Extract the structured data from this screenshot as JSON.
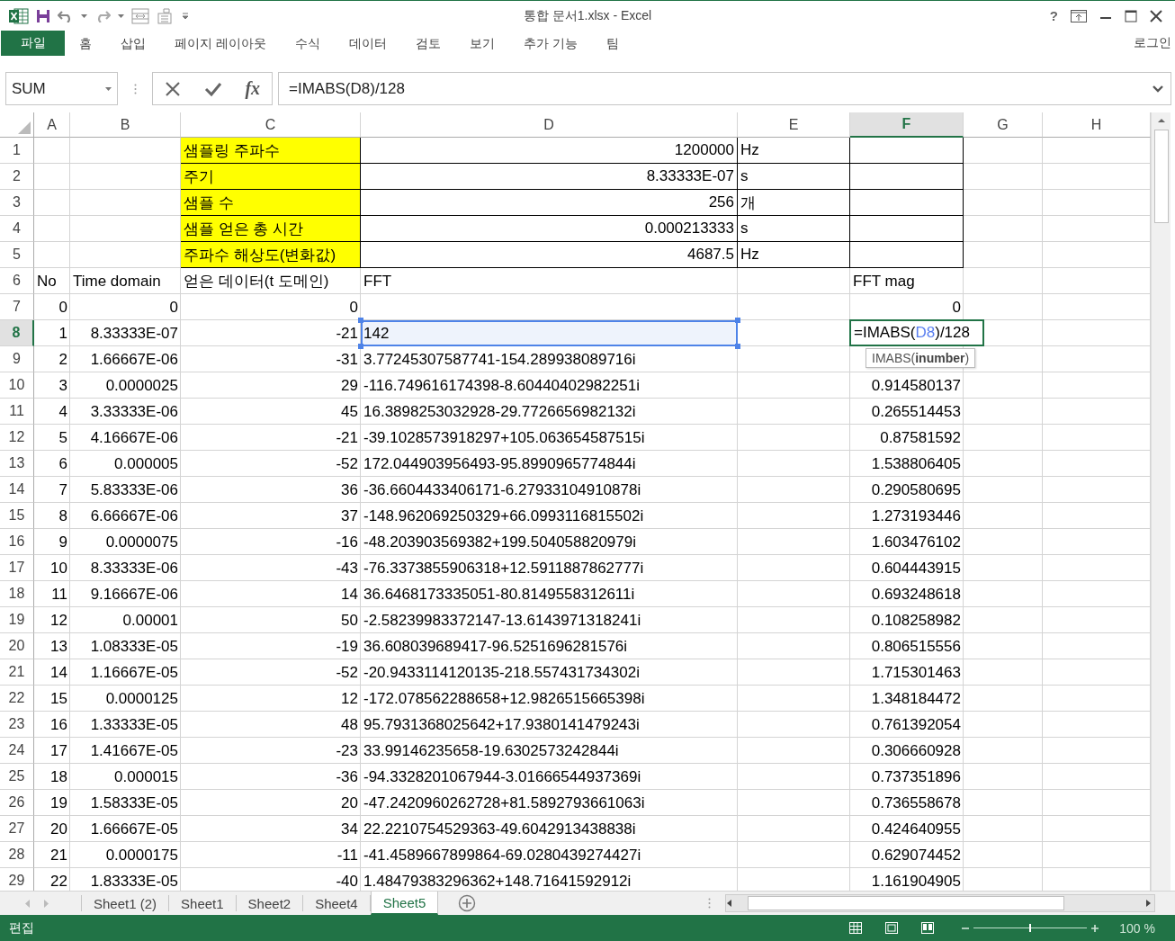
{
  "window": {
    "title": "통합 문서1.xlsx - Excel",
    "help": "?"
  },
  "ribbon_tabs": [
    {
      "label": "파일",
      "kind": "file",
      "selected": false
    },
    {
      "label": "홈",
      "kind": "tab",
      "selected": false
    },
    {
      "label": "삽입",
      "kind": "tab",
      "selected": false
    },
    {
      "label": "페이지 레이아웃",
      "kind": "tab",
      "selected": false
    },
    {
      "label": "수식",
      "kind": "tab",
      "selected": false
    },
    {
      "label": "데이터",
      "kind": "tab",
      "selected": false
    },
    {
      "label": "검토",
      "kind": "tab",
      "selected": false
    },
    {
      "label": "보기",
      "kind": "tab",
      "selected": false
    },
    {
      "label": "추가 기능",
      "kind": "tab",
      "selected": false
    },
    {
      "label": "팀",
      "kind": "tab",
      "selected": false
    }
  ],
  "account": "로그인",
  "formula_bar": {
    "name_box": "SUM",
    "function_button": "fx",
    "formula": "=IMABS(D8)/128"
  },
  "columns": [
    {
      "label": "A",
      "selected": false
    },
    {
      "label": "B",
      "selected": false
    },
    {
      "label": "C",
      "selected": false
    },
    {
      "label": "D",
      "selected": false
    },
    {
      "label": "E",
      "selected": false
    },
    {
      "label": "F",
      "selected": true
    },
    {
      "label": "G",
      "selected": false
    },
    {
      "label": "H",
      "selected": false
    }
  ],
  "rows": [
    {
      "header": "1",
      "selected": false,
      "boxed": true,
      "cells": {
        "C": {
          "text": "샘플링 주파수",
          "kind": "highlight"
        },
        "D": {
          "text": "1200000",
          "kind": "number"
        },
        "E": {
          "text": "Hz",
          "kind": "text"
        }
      }
    },
    {
      "header": "2",
      "selected": false,
      "boxed": true,
      "cells": {
        "C": {
          "text": "주기",
          "kind": "highlight"
        },
        "D": {
          "text": "8.33333E-07",
          "kind": "number"
        },
        "E": {
          "text": "s",
          "kind": "text"
        }
      }
    },
    {
      "header": "3",
      "selected": false,
      "boxed": true,
      "cells": {
        "C": {
          "text": "샘플 수",
          "kind": "highlight"
        },
        "D": {
          "text": "256",
          "kind": "number"
        },
        "E": {
          "text": "개",
          "kind": "text"
        }
      }
    },
    {
      "header": "4",
      "selected": false,
      "boxed": true,
      "cells": {
        "C": {
          "text": "샘플 얻은 총 시간",
          "kind": "highlight"
        },
        "D": {
          "text": "0.000213333",
          "kind": "number"
        },
        "E": {
          "text": "s",
          "kind": "text"
        }
      }
    },
    {
      "header": "5",
      "selected": false,
      "boxed": true,
      "cells": {
        "C": {
          "text": "주파수 해상도(변화값)",
          "kind": "highlight"
        },
        "D": {
          "text": "4687.5",
          "kind": "number"
        },
        "E": {
          "text": "Hz",
          "kind": "text"
        }
      }
    },
    {
      "header": "6",
      "selected": false,
      "cells": {
        "A": {
          "text": "No",
          "kind": "text"
        },
        "B": {
          "text": "Time domain",
          "kind": "text"
        },
        "C": {
          "text": "얻은 데이터(t 도메인)",
          "kind": "text"
        },
        "D": {
          "text": "FFT",
          "kind": "text"
        },
        "F": {
          "text": "FFT mag",
          "kind": "text"
        }
      }
    },
    {
      "header": "7",
      "selected": false,
      "cells": {
        "A": {
          "text": "0",
          "kind": "number"
        },
        "B": {
          "text": "0",
          "kind": "number"
        },
        "C": {
          "text": "0",
          "kind": "number"
        },
        "F": {
          "text": "0",
          "kind": "number"
        }
      }
    },
    {
      "header": "8",
      "selected": true,
      "cells": {
        "A": {
          "text": "1",
          "kind": "number"
        },
        "B": {
          "text": "8.33333E-07",
          "kind": "number"
        },
        "C": {
          "text": "-21",
          "kind": "number"
        },
        "D": {
          "text": "142",
          "kind": "text",
          "referenced": true
        },
        "F": {
          "kind": "editing",
          "text": "=IMABS(",
          "reference": "D8",
          "tail": ")/128"
        }
      }
    },
    {
      "header": "9",
      "selected": false,
      "cells": {
        "A": {
          "text": "2",
          "kind": "number"
        },
        "B": {
          "text": "1.66667E-06",
          "kind": "number"
        },
        "C": {
          "text": "-31",
          "kind": "number"
        },
        "D": {
          "text": "3.77245307587741-154.289938089716i",
          "kind": "text"
        }
      }
    },
    {
      "header": "10",
      "selected": false,
      "cells": {
        "A": {
          "text": "3",
          "kind": "number"
        },
        "B": {
          "text": "0.0000025",
          "kind": "number"
        },
        "C": {
          "text": "29",
          "kind": "number"
        },
        "D": {
          "text": "-116.749616174398-8.60440402982251i",
          "kind": "text"
        },
        "F": {
          "text": "0.914580137",
          "kind": "number"
        }
      }
    },
    {
      "header": "11",
      "selected": false,
      "cells": {
        "A": {
          "text": "4",
          "kind": "number"
        },
        "B": {
          "text": "3.33333E-06",
          "kind": "number"
        },
        "C": {
          "text": "45",
          "kind": "number"
        },
        "D": {
          "text": "16.3898253032928-29.7726656982132i",
          "kind": "text"
        },
        "F": {
          "text": "0.265514453",
          "kind": "number"
        }
      }
    },
    {
      "header": "12",
      "selected": false,
      "cells": {
        "A": {
          "text": "5",
          "kind": "number"
        },
        "B": {
          "text": "4.16667E-06",
          "kind": "number"
        },
        "C": {
          "text": "-21",
          "kind": "number"
        },
        "D": {
          "text": "-39.1028573918297+105.063654587515i",
          "kind": "text"
        },
        "F": {
          "text": "0.87581592",
          "kind": "number"
        }
      }
    },
    {
      "header": "13",
      "selected": false,
      "cells": {
        "A": {
          "text": "6",
          "kind": "number"
        },
        "B": {
          "text": "0.000005",
          "kind": "number"
        },
        "C": {
          "text": "-52",
          "kind": "number"
        },
        "D": {
          "text": "172.044903956493-95.8990965774844i",
          "kind": "text"
        },
        "F": {
          "text": "1.538806405",
          "kind": "number"
        }
      }
    },
    {
      "header": "14",
      "selected": false,
      "cells": {
        "A": {
          "text": "7",
          "kind": "number"
        },
        "B": {
          "text": "5.83333E-06",
          "kind": "number"
        },
        "C": {
          "text": "36",
          "kind": "number"
        },
        "D": {
          "text": "-36.6604433406171-6.27933104910878i",
          "kind": "text"
        },
        "F": {
          "text": "0.290580695",
          "kind": "number"
        }
      }
    },
    {
      "header": "15",
      "selected": false,
      "cells": {
        "A": {
          "text": "8",
          "kind": "number"
        },
        "B": {
          "text": "6.66667E-06",
          "kind": "number"
        },
        "C": {
          "text": "37",
          "kind": "number"
        },
        "D": {
          "text": "-148.962069250329+66.0993116815502i",
          "kind": "text"
        },
        "F": {
          "text": "1.273193446",
          "kind": "number"
        }
      }
    },
    {
      "header": "16",
      "selected": false,
      "cells": {
        "A": {
          "text": "9",
          "kind": "number"
        },
        "B": {
          "text": "0.0000075",
          "kind": "number"
        },
        "C": {
          "text": "-16",
          "kind": "number"
        },
        "D": {
          "text": "-48.203903569382+199.504058820979i",
          "kind": "text"
        },
        "F": {
          "text": "1.603476102",
          "kind": "number"
        }
      }
    },
    {
      "header": "17",
      "selected": false,
      "cells": {
        "A": {
          "text": "10",
          "kind": "number"
        },
        "B": {
          "text": "8.33333E-06",
          "kind": "number"
        },
        "C": {
          "text": "-43",
          "kind": "number"
        },
        "D": {
          "text": "-76.3373855906318+12.5911887862777i",
          "kind": "text"
        },
        "F": {
          "text": "0.604443915",
          "kind": "number"
        }
      }
    },
    {
      "header": "18",
      "selected": false,
      "cells": {
        "A": {
          "text": "11",
          "kind": "number"
        },
        "B": {
          "text": "9.16667E-06",
          "kind": "number"
        },
        "C": {
          "text": "14",
          "kind": "number"
        },
        "D": {
          "text": "36.6468173335051-80.8149558312611i",
          "kind": "text"
        },
        "F": {
          "text": "0.693248618",
          "kind": "number"
        }
      }
    },
    {
      "header": "19",
      "selected": false,
      "cells": {
        "A": {
          "text": "12",
          "kind": "number"
        },
        "B": {
          "text": "0.00001",
          "kind": "number"
        },
        "C": {
          "text": "50",
          "kind": "number"
        },
        "D": {
          "text": "-2.58239983372147-13.6143971318241i",
          "kind": "text"
        },
        "F": {
          "text": "0.108258982",
          "kind": "number"
        }
      }
    },
    {
      "header": "20",
      "selected": false,
      "cells": {
        "A": {
          "text": "13",
          "kind": "number"
        },
        "B": {
          "text": "1.08333E-05",
          "kind": "number"
        },
        "C": {
          "text": "-19",
          "kind": "number"
        },
        "D": {
          "text": "36.608039689417-96.5251696281576i",
          "kind": "text"
        },
        "F": {
          "text": "0.806515556",
          "kind": "number"
        }
      }
    },
    {
      "header": "21",
      "selected": false,
      "cells": {
        "A": {
          "text": "14",
          "kind": "number"
        },
        "B": {
          "text": "1.16667E-05",
          "kind": "number"
        },
        "C": {
          "text": "-52",
          "kind": "number"
        },
        "D": {
          "text": "-20.9433114120135-218.557431734302i",
          "kind": "text"
        },
        "F": {
          "text": "1.715301463",
          "kind": "number"
        }
      }
    },
    {
      "header": "22",
      "selected": false,
      "cells": {
        "A": {
          "text": "15",
          "kind": "number"
        },
        "B": {
          "text": "0.0000125",
          "kind": "number"
        },
        "C": {
          "text": "12",
          "kind": "number"
        },
        "D": {
          "text": "-172.078562288658+12.9826515665398i",
          "kind": "text"
        },
        "F": {
          "text": "1.348184472",
          "kind": "number"
        }
      }
    },
    {
      "header": "23",
      "selected": false,
      "cells": {
        "A": {
          "text": "16",
          "kind": "number"
        },
        "B": {
          "text": "1.33333E-05",
          "kind": "number"
        },
        "C": {
          "text": "48",
          "kind": "number"
        },
        "D": {
          "text": "95.7931368025642+17.9380141479243i",
          "kind": "text"
        },
        "F": {
          "text": "0.761392054",
          "kind": "number"
        }
      }
    },
    {
      "header": "24",
      "selected": false,
      "cells": {
        "A": {
          "text": "17",
          "kind": "number"
        },
        "B": {
          "text": "1.41667E-05",
          "kind": "number"
        },
        "C": {
          "text": "-23",
          "kind": "number"
        },
        "D": {
          "text": "33.99146235658-19.6302573242844i",
          "kind": "text"
        },
        "F": {
          "text": "0.306660928",
          "kind": "number"
        }
      }
    },
    {
      "header": "25",
      "selected": false,
      "cells": {
        "A": {
          "text": "18",
          "kind": "number"
        },
        "B": {
          "text": "0.000015",
          "kind": "number"
        },
        "C": {
          "text": "-36",
          "kind": "number"
        },
        "D": {
          "text": "-94.3328201067944-3.01666544937369i",
          "kind": "text"
        },
        "F": {
          "text": "0.737351896",
          "kind": "number"
        }
      }
    },
    {
      "header": "26",
      "selected": false,
      "cells": {
        "A": {
          "text": "19",
          "kind": "number"
        },
        "B": {
          "text": "1.58333E-05",
          "kind": "number"
        },
        "C": {
          "text": "20",
          "kind": "number"
        },
        "D": {
          "text": "-47.2420960262728+81.5892793661063i",
          "kind": "text"
        },
        "F": {
          "text": "0.736558678",
          "kind": "number"
        }
      }
    },
    {
      "header": "27",
      "selected": false,
      "cells": {
        "A": {
          "text": "20",
          "kind": "number"
        },
        "B": {
          "text": "1.66667E-05",
          "kind": "number"
        },
        "C": {
          "text": "34",
          "kind": "number"
        },
        "D": {
          "text": "22.2210754529363-49.6042913438838i",
          "kind": "text"
        },
        "F": {
          "text": "0.424640955",
          "kind": "number"
        }
      }
    },
    {
      "header": "28",
      "selected": false,
      "cells": {
        "A": {
          "text": "21",
          "kind": "number"
        },
        "B": {
          "text": "0.0000175",
          "kind": "number"
        },
        "C": {
          "text": "-11",
          "kind": "number"
        },
        "D": {
          "text": "-41.4589667899864-69.0280439274427i",
          "kind": "text"
        },
        "F": {
          "text": "0.629074452",
          "kind": "number"
        }
      }
    },
    {
      "header": "29",
      "selected": false,
      "cells": {
        "A": {
          "text": "22",
          "kind": "number"
        },
        "B": {
          "text": "1.83333E-05",
          "kind": "number"
        },
        "C": {
          "text": "-40",
          "kind": "number"
        },
        "D": {
          "text": "1.48479383296362+148.71641592912i",
          "kind": "text"
        },
        "F": {
          "text": "1.161904905",
          "kind": "number"
        }
      }
    }
  ],
  "tooltip": "IMABS(**inumber**)",
  "sheet_tabs": [
    {
      "label": "Sheet1 (2)",
      "selected": false
    },
    {
      "label": "Sheet1",
      "selected": false
    },
    {
      "label": "Sheet2",
      "selected": false
    },
    {
      "label": "Sheet4",
      "selected": false
    },
    {
      "label": "Sheet5",
      "selected": true
    }
  ],
  "status_bar": {
    "mode": "편집",
    "zoom_slider": {
      "level": 0.5
    },
    "zoom": "100 %"
  }
}
